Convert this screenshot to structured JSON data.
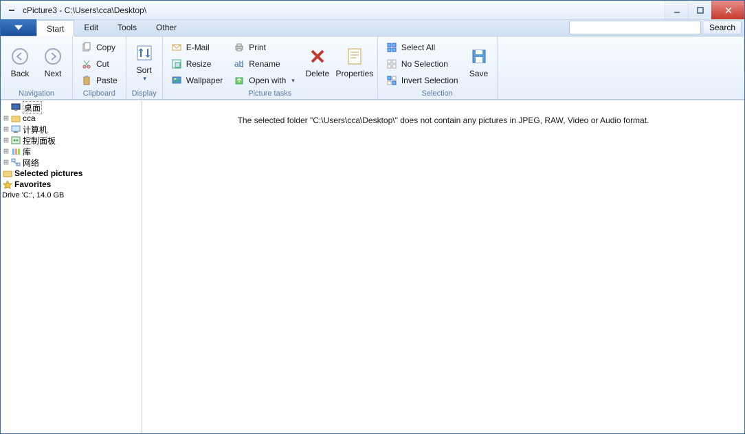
{
  "window": {
    "title": "cPicture3 - C:\\Users\\cca\\Desktop\\"
  },
  "tabs": {
    "start": "Start",
    "edit": "Edit",
    "tools": "Tools",
    "other": "Other"
  },
  "search": {
    "placeholder": "",
    "button": "Search"
  },
  "ribbon": {
    "navigation": {
      "label": "Navigation",
      "back": "Back",
      "next": "Next"
    },
    "clipboard": {
      "label": "Clipboard",
      "copy": "Copy",
      "cut": "Cut",
      "paste": "Paste"
    },
    "display": {
      "label": "Display",
      "sort": "Sort"
    },
    "picture_tasks": {
      "label": "Picture tasks",
      "email": "E-Mail",
      "resize": "Resize",
      "wallpaper": "Wallpaper",
      "print": "Print",
      "rename": "Rename",
      "open_with": "Open with",
      "delete": "Delete",
      "properties": "Properties"
    },
    "selection": {
      "label": "Selection",
      "select_all": "Select All",
      "no_selection": "No Selection",
      "invert": "Invert Selection",
      "save": "Save"
    }
  },
  "tree": {
    "desktop": "桌面",
    "cca": "cca",
    "computer": "计算机",
    "control_panel": "控制面板",
    "libraries": "库",
    "network": "网络",
    "selected_pictures": "Selected pictures",
    "favorites": "Favorites",
    "drive": "Drive 'C:', 14.0 GB"
  },
  "main": {
    "empty": "The selected folder \"C:\\Users\\cca\\Desktop\\\" does not contain any pictures in JPEG, RAW, Video or Audio format."
  }
}
